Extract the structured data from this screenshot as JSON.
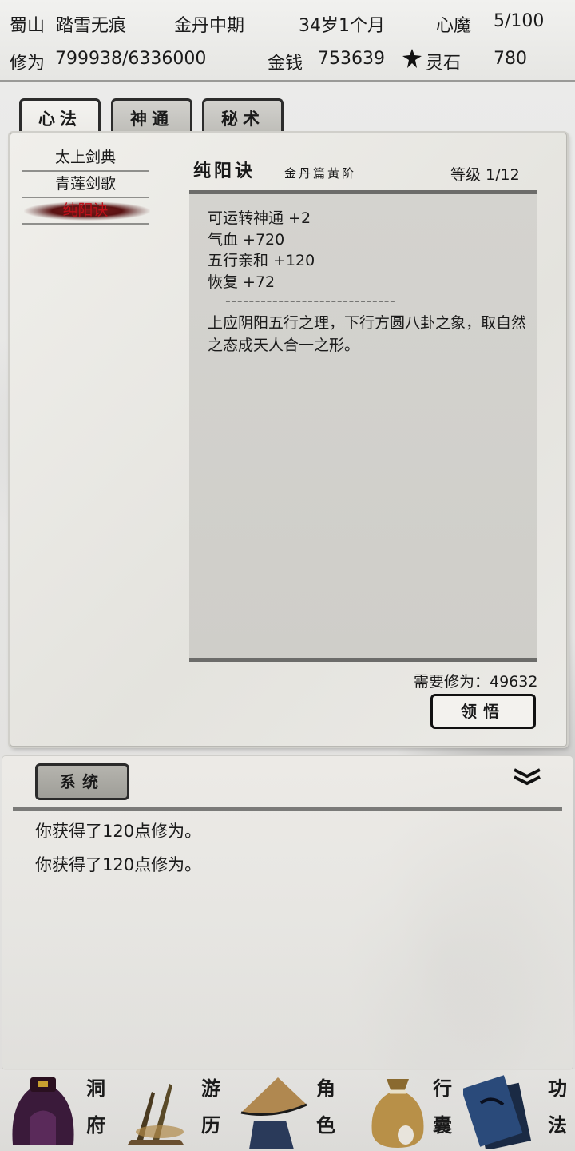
{
  "status": {
    "sect": "蜀山",
    "name": "踏雪无痕",
    "realm": "金丹中期",
    "age": "34岁1个月",
    "demon_label": "心魔",
    "demon_value": "5/100",
    "cultivation_label": "修为",
    "cultivation_value": "799938/6336000",
    "money_label": "金钱",
    "money_value": "753639",
    "stone_label": "灵石",
    "stone_value": "780"
  },
  "tabs": [
    {
      "label": "心法"
    },
    {
      "label": "神通"
    },
    {
      "label": "秘术"
    }
  ],
  "sidebar": {
    "items": [
      {
        "label": "太上剑典"
      },
      {
        "label": "青莲剑歌"
      },
      {
        "label": "纯阳诀"
      }
    ]
  },
  "detail": {
    "title": "纯阳诀",
    "subtitle": "金丹篇黄阶",
    "level": "等级  1/12",
    "effects": [
      "可运转神通 +2",
      "气血 +720",
      "五行亲和 +120",
      "恢复 +72"
    ],
    "divider": "-----------------------------",
    "description": "上应阴阳五行之理，下行方圆八卦之象，取自然之态成天人合一之形。",
    "requirement": "需要修为：49632",
    "button": "领悟"
  },
  "log": {
    "tab": "系统",
    "lines": [
      "你获得了120点修为。",
      "你获得了120点修为。"
    ]
  },
  "nav": [
    {
      "label": "洞府",
      "icon": "cave-icon"
    },
    {
      "label": "游历",
      "icon": "travel-icon"
    },
    {
      "label": "角色",
      "icon": "character-icon"
    },
    {
      "label": "行囊",
      "icon": "bag-icon"
    },
    {
      "label": "功法",
      "icon": "books-icon"
    }
  ],
  "colors": {
    "selected": "#c0101a",
    "ink": "#1a1a1a"
  }
}
